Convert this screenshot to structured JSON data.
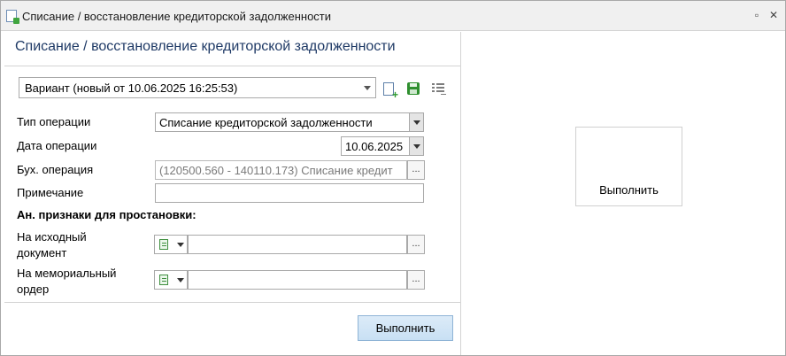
{
  "window": {
    "title": "Списание / восстановление кредиторской задолженности",
    "restore_glyph": "▫",
    "close_glyph": "✕"
  },
  "panel": {
    "header": "Списание / восстановление кредиторской задолженности"
  },
  "variant": {
    "value": "Вариант (новый от 10.06.2025 16:25:53)"
  },
  "toolbar_icons": [
    "new-document-icon",
    "save-icon",
    "list-settings-icon"
  ],
  "form": {
    "operation_type": {
      "label": "Тип операции",
      "value": "Списание кредиторской задолженности"
    },
    "operation_date": {
      "label": "Дата операции",
      "value": "10.06.2025"
    },
    "accounting_op": {
      "label": "Бух. операция",
      "value": "(120500.560 - 140110.173) Списание кредит",
      "ellipsis": "..."
    },
    "note": {
      "label": "Примечание",
      "value": ""
    },
    "analytics_title": "Ан. признаки для простановки:",
    "source_doc": {
      "label_line1": "На исходный",
      "label_line2": "документ",
      "value": "",
      "ellipsis": "..."
    },
    "memorial_order": {
      "label_line1": "На мемориальный",
      "label_line2": "ордер",
      "value": "",
      "ellipsis": "..."
    }
  },
  "buttons": {
    "execute": "Выполнить",
    "execute_right": "Выполнить"
  }
}
